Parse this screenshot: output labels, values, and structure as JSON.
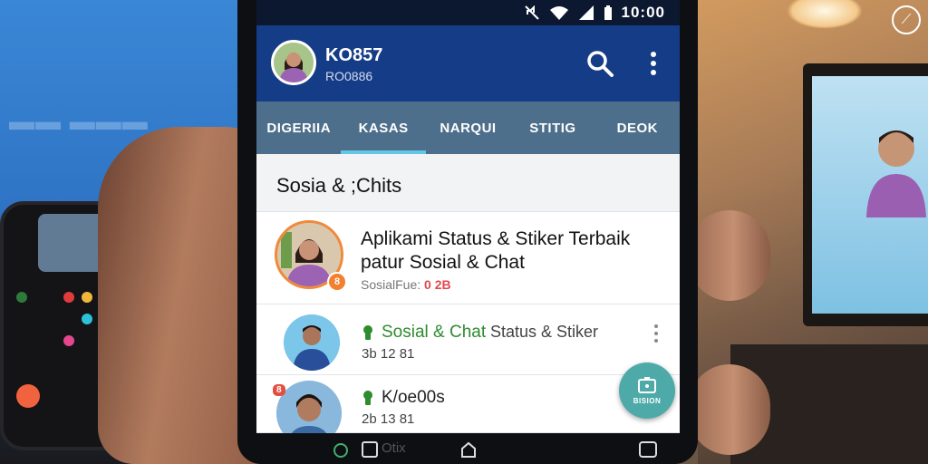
{
  "status_bar": {
    "time": "10:00",
    "icons": [
      "mute-icon",
      "wifi-icon",
      "signal-icon",
      "battery-icon"
    ]
  },
  "profile": {
    "name": "KO857",
    "sub": "RO0886"
  },
  "appbar_icons": [
    "search-icon",
    "more-vert-icon"
  ],
  "tabs": [
    {
      "label": "DIGERIIA",
      "active": false
    },
    {
      "label": "KASAS",
      "active": true
    },
    {
      "label": "NARQUI",
      "active": false
    },
    {
      "label": "STITIG",
      "active": false
    },
    {
      "label": "DEOK",
      "active": false
    }
  ],
  "section_title": "Sosia & ;Chits",
  "items": [
    {
      "title": "Aplikami Status & Stiker Terbaik patur Sosial & Chat",
      "sub_label": "SosialFue:",
      "sub_count": "0 2B",
      "badge": "8"
    },
    {
      "name": "Sosial & Chat",
      "tag": "Status & Stiker",
      "time": "3b 12 81"
    },
    {
      "name": "K/oe00s",
      "time": "2b 13 81",
      "badge": "8"
    }
  ],
  "fab_label": "BISION",
  "nav_label": "Otix",
  "colors": {
    "appbar": "#153c86",
    "tabs": "#4d6f8b",
    "tab_indicator": "#62c7e6",
    "fab": "#4eaaa9",
    "online_green": "#2e8b2e"
  }
}
